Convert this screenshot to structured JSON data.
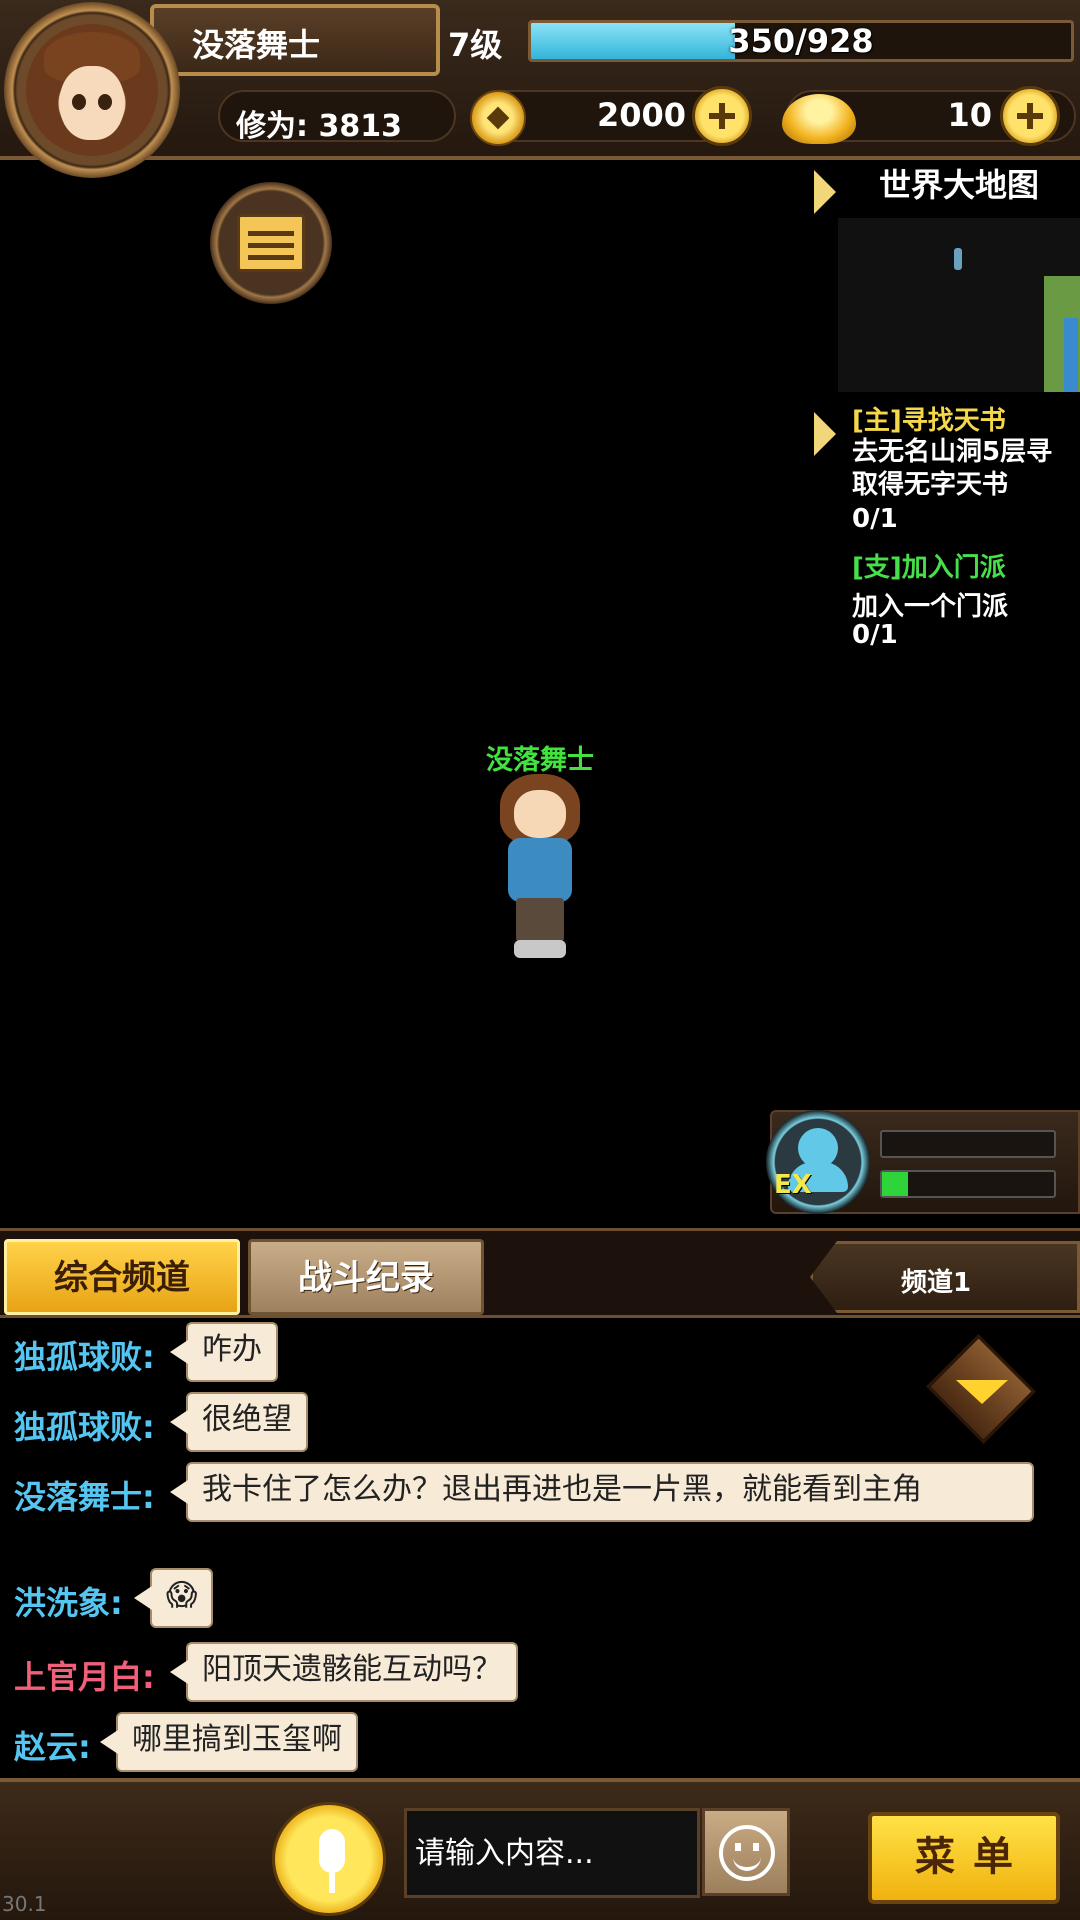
{
  "player": {
    "name": "没落舞士",
    "level": "7级",
    "exp_text": "350/928",
    "exp_current": 350,
    "exp_max": 928,
    "cultivation": "修为: 3813"
  },
  "currency": {
    "coins": "2000",
    "ingots": "10"
  },
  "map": {
    "title": "世界大地图"
  },
  "quests": {
    "main": {
      "title": "[主]寻找天书",
      "desc": "去无名山洞5层寻取得无字天书",
      "progress": "0/1"
    },
    "side": {
      "title": "[支]加入门派",
      "desc": "加入一个门派",
      "progress": "0/1"
    }
  },
  "character": {
    "name": "没落舞士"
  },
  "ex_skill": {
    "label": "EX",
    "bar1_fill": 0,
    "bar2_fill": 0.15
  },
  "chat": {
    "tabs": [
      "综合频道",
      "战斗纪录"
    ],
    "channel": "频道1",
    "messages": [
      {
        "sender": "独孤球败:",
        "text": "咋办",
        "color": "#55c6f2"
      },
      {
        "sender": "独孤球败:",
        "text": "很绝望",
        "color": "#55c6f2"
      },
      {
        "sender": "没落舞士:",
        "text": "我卡住了怎么办？退出再进也是一片黑，就能看到主角",
        "color": "#55c6f2"
      },
      {
        "sender": "洪洗象:",
        "text": "😱",
        "color": "#55c6f2"
      },
      {
        "sender": "上官月白:",
        "text": "阳顶天遗骸能互动吗？",
        "color": "#f0607a"
      },
      {
        "sender": "赵云:",
        "text": "哪里搞到玉玺啊",
        "color": "#55c6f2"
      }
    ]
  },
  "bottom": {
    "input_placeholder": "请输入内容...",
    "menu_label": "菜单",
    "version": "30.1"
  }
}
